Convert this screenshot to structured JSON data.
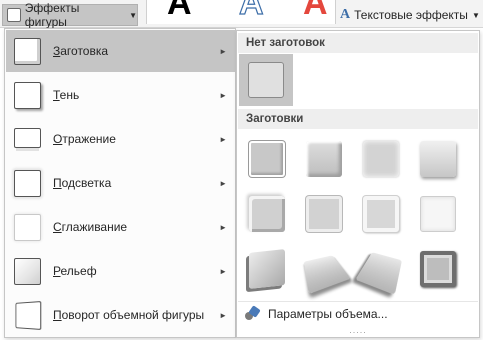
{
  "ribbon": {
    "shape_effects_label": "Эффекты фигуры",
    "text_effects_label": "Текстовые эффекты",
    "wordart_letter": "A"
  },
  "menu": {
    "items": [
      {
        "key": "Заготовка",
        "label": "Заготовка",
        "selected": true
      },
      {
        "key": "Тень",
        "label": "Тень"
      },
      {
        "key": "Отражение",
        "label": "Отражение"
      },
      {
        "key": "Подсветка",
        "label": "Подсветка"
      },
      {
        "key": "Сглаживание",
        "label": "Сглаживание"
      },
      {
        "key": "Рельеф",
        "label": "Рельеф"
      },
      {
        "key": "Поворот объемной фигуры",
        "label": "Поворот объемной фигуры"
      }
    ]
  },
  "flyout": {
    "no_preset_header": "Нет заготовок",
    "presets_header": "Заготовки",
    "preset_count": 12,
    "footer_label": "Параметры объема...",
    "grip": "....."
  },
  "colors": {
    "selected_bg": "#c5c5c5",
    "section_header_bg": "#eeeeee",
    "accent_blue": "#3d6ea8",
    "wordart_red": "#e4473d"
  }
}
